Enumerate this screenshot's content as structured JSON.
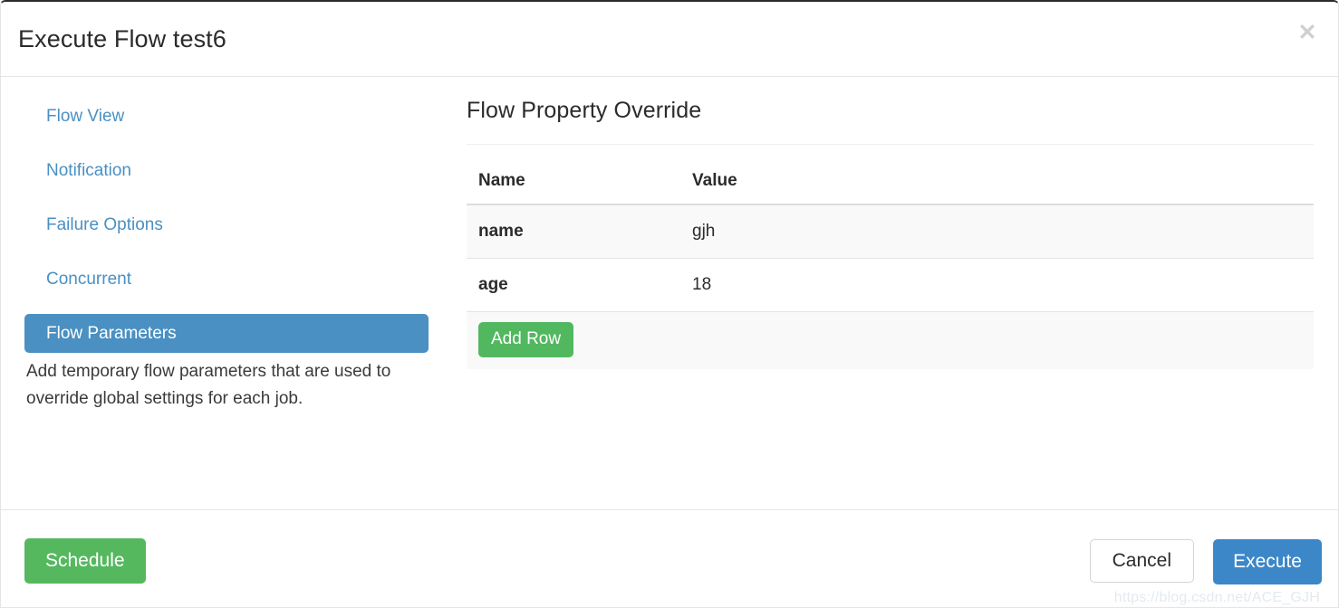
{
  "dialog": {
    "title": "Execute Flow test6",
    "close_icon": "close-icon",
    "close_glyph": "✕"
  },
  "sidebar": {
    "items": [
      {
        "label": "Flow View",
        "active": false
      },
      {
        "label": "Notification",
        "active": false
      },
      {
        "label": "Failure Options",
        "active": false
      },
      {
        "label": "Concurrent",
        "active": false
      },
      {
        "label": "Flow Parameters",
        "active": true
      }
    ],
    "description": "Add temporary flow parameters that are used to override global settings for each job."
  },
  "panel": {
    "title": "Flow Property Override",
    "table": {
      "columns": [
        "Name",
        "Value"
      ],
      "rows": [
        {
          "name": "name",
          "value": "gjh"
        },
        {
          "name": "age",
          "value": "18"
        }
      ],
      "add_row_label": "Add Row"
    }
  },
  "footer": {
    "schedule_label": "Schedule",
    "cancel_label": "Cancel",
    "execute_label": "Execute"
  },
  "watermark": "https://blog.csdn.net/ACE_GJH",
  "colors": {
    "accent_blue": "#4a90c2",
    "execute_blue": "#3b87c8",
    "green": "#55b85f",
    "add_row_green": "#52b860",
    "link_blue": "#4a90c2",
    "row_stripe": "#f9f9f9",
    "border": "#e4e4e4"
  }
}
